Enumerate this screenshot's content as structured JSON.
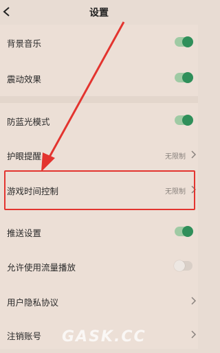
{
  "header": {
    "title": "设置"
  },
  "rows": [
    {
      "label": "背景音乐",
      "type": "toggle",
      "state": "on"
    },
    {
      "label": "震动效果",
      "type": "toggle",
      "state": "on"
    },
    {
      "label": "防蓝光模式",
      "type": "toggle",
      "state": "on"
    },
    {
      "label": "护眼提醒",
      "type": "link",
      "value": "无限制"
    },
    {
      "label": "游戏时间控制",
      "type": "link",
      "value": "无限制"
    },
    {
      "label": "推送设置",
      "type": "toggle",
      "state": "on"
    },
    {
      "label": "允许使用流量播放",
      "type": "toggle",
      "state": "off"
    },
    {
      "label": "用户隐私协议",
      "type": "link"
    },
    {
      "label": "注销账号",
      "type": "link"
    }
  ],
  "watermark": "GASK.CC",
  "colors": {
    "toggle_on": "#2f8f5a",
    "annotation": "#e3342f"
  }
}
